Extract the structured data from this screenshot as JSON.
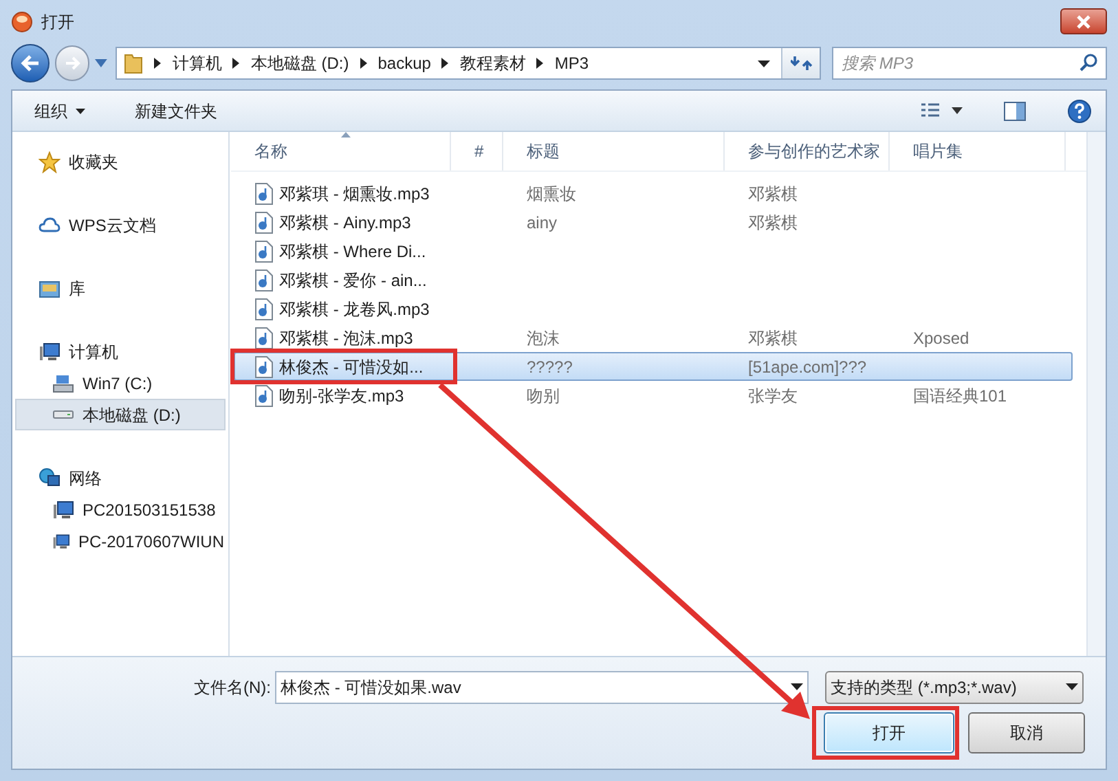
{
  "window": {
    "title": "打开"
  },
  "address": {
    "path": [
      "计算机",
      "本地磁盘 (D:)",
      "backup",
      "教程素材",
      "MP3"
    ]
  },
  "search": {
    "placeholder": "搜索 MP3"
  },
  "toolbar": {
    "organize": "组织",
    "new_folder": "新建文件夹"
  },
  "sidebar": {
    "items": [
      {
        "kind": "star",
        "label": "收藏夹",
        "selected": false
      },
      {
        "kind": "cloud",
        "label": "WPS云文档",
        "selected": false
      },
      {
        "kind": "library",
        "label": "库",
        "selected": false
      },
      {
        "kind": "computer",
        "label": "计算机",
        "selected": false,
        "children": [
          {
            "kind": "system-drive",
            "label": "Win7 (C:)",
            "selected": false
          },
          {
            "kind": "drive",
            "label": "本地磁盘 (D:)",
            "selected": true
          }
        ]
      },
      {
        "kind": "network",
        "label": "网络",
        "selected": false,
        "children": [
          {
            "kind": "computer",
            "label": "PC201503151538",
            "selected": false
          },
          {
            "kind": "computer",
            "label": "PC-20170607WIUN",
            "selected": false
          }
        ]
      }
    ]
  },
  "table": {
    "columns": [
      "名称",
      "#",
      "标题",
      "参与创作的艺术家",
      "唱片集"
    ],
    "rows": [
      {
        "name": "邓紫琪 - 烟熏妆.mp3",
        "title": "烟熏妆",
        "artist": "邓紫棋",
        "selected": false
      },
      {
        "name": "邓紫棋 - Ainy.mp3",
        "title": "ainy",
        "artist": "邓紫棋",
        "selected": false
      },
      {
        "name": "邓紫棋 - Where Di...",
        "selected": false
      },
      {
        "name": "邓紫棋 - 爱你 - ain...",
        "selected": false
      },
      {
        "name": "邓紫棋 - 龙卷风.mp3",
        "selected": false
      },
      {
        "name": "邓紫棋 - 泡沫.mp3",
        "title": "泡沫",
        "artist": "邓紫棋",
        "album": "Xposed",
        "selected": false
      },
      {
        "name": "林俊杰 - 可惜没如...",
        "title": "?????",
        "artist": "[51ape.com]???",
        "selected": true
      },
      {
        "name": "吻别-张学友.mp3",
        "title": "吻别",
        "artist": "张学友",
        "album": "国语经典101",
        "selected": false
      }
    ]
  },
  "file_name": {
    "label": "文件名(N):",
    "value": "林俊杰 - 可惜没如果.wav"
  },
  "file_type": {
    "value": "支持的类型 (*.mp3;*.wav)"
  },
  "buttons": [
    {
      "kind": "open",
      "label": "打开"
    },
    {
      "kind": "cancel",
      "label": "取消"
    }
  ]
}
